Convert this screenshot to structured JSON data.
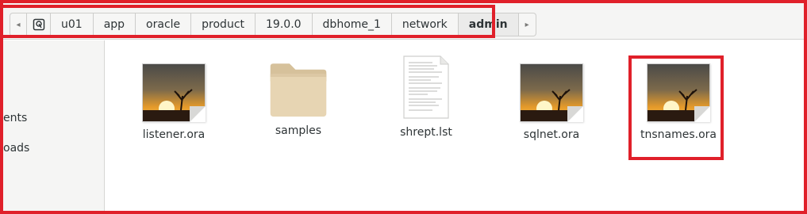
{
  "pathbar": {
    "back_arrow": "◂",
    "forward_arrow": "▸",
    "home_icon": "disk-icon",
    "segments": [
      "u01",
      "app",
      "oracle",
      "product",
      "19.0.0",
      "dbhome_1",
      "network",
      "admin"
    ],
    "current": "admin"
  },
  "sidebar": {
    "items": [
      "ents",
      "oads"
    ]
  },
  "files": [
    {
      "name": "listener.ora",
      "icon": "image-thumbnail-icon"
    },
    {
      "name": "samples",
      "icon": "folder-icon"
    },
    {
      "name": "shrept.lst",
      "icon": "text-document-icon"
    },
    {
      "name": "sqlnet.ora",
      "icon": "image-thumbnail-icon"
    },
    {
      "name": "tnsnames.ora",
      "icon": "image-thumbnail-icon"
    }
  ],
  "colors": {
    "annotation_red": "#e0202a",
    "folder": "#e7d5b3",
    "folder_tab": "#d6c19b"
  }
}
